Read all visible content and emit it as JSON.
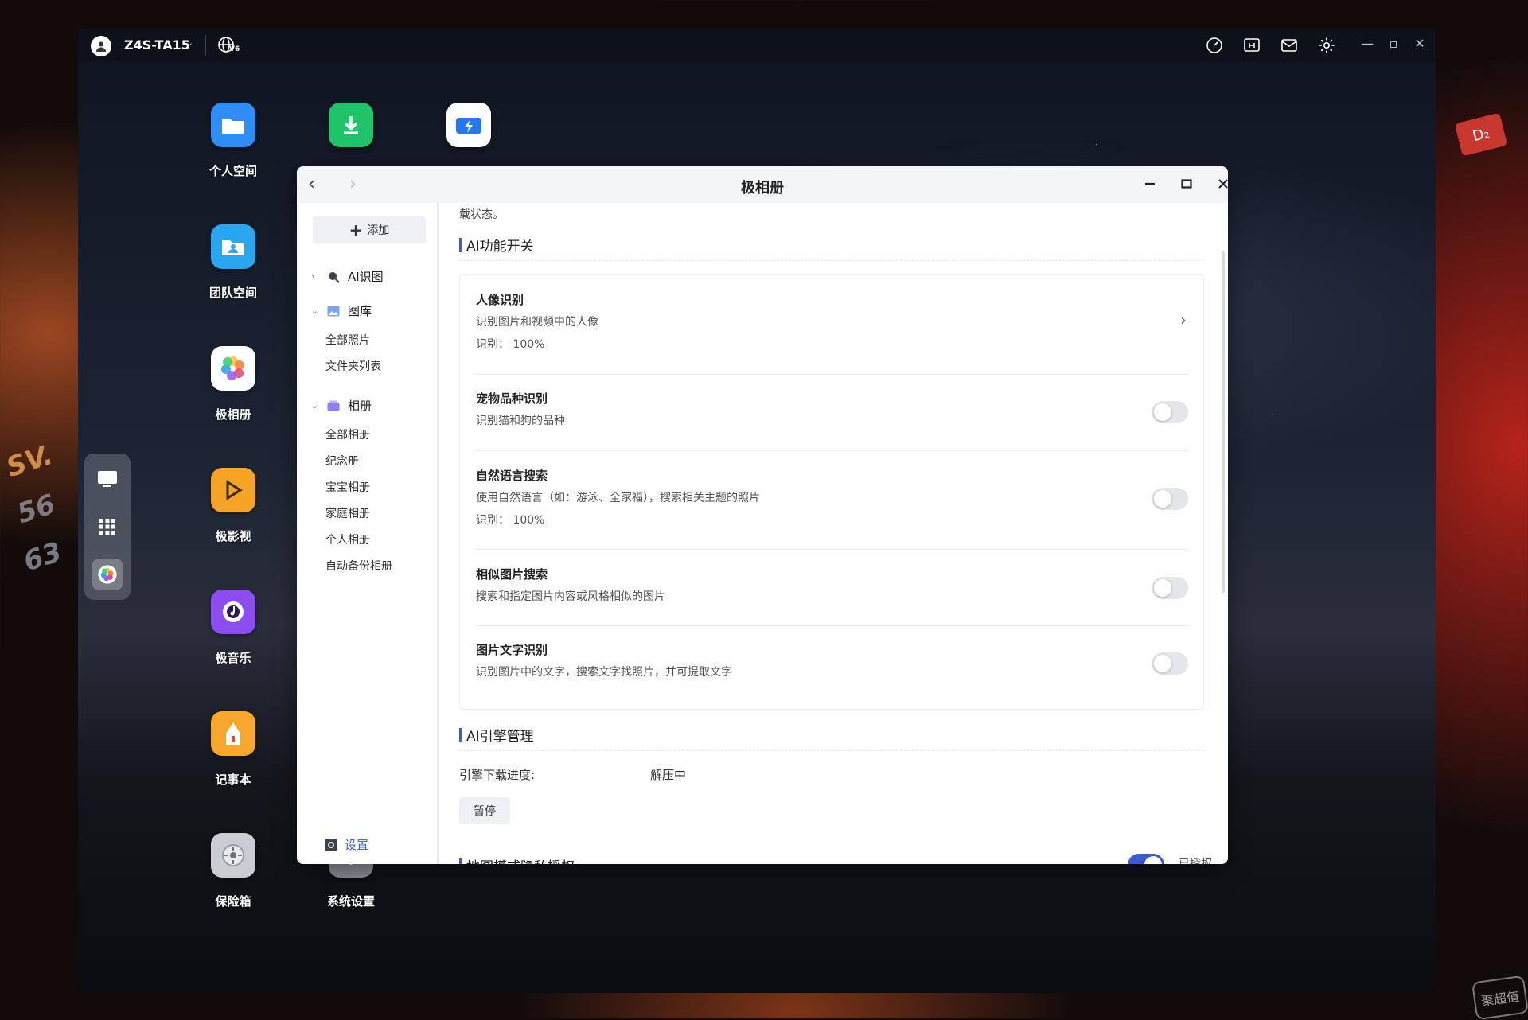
{
  "outer": {
    "deco_text_1": "SV.",
    "deco_text_2": "56",
    "deco_text_3": "63",
    "badge": "D₂",
    "watermark": "聚超值"
  },
  "topbar": {
    "device_name": "Z4S-TA15",
    "globe_badge": "V6"
  },
  "desktop_apps": [
    {
      "label": "个人空间",
      "icon": "folder-icon",
      "color": "#2f8ef5"
    },
    {
      "label": "",
      "icon": "download-icon",
      "color": "#1ec36a"
    },
    {
      "label": "",
      "icon": "lightning-icon",
      "color": "#2477ef"
    },
    {
      "label": "团队空间",
      "icon": "team-folder-icon",
      "color": "#2aa6f1"
    },
    {
      "label": "极相册",
      "icon": "photo-flower-icon",
      "color": "#ffffff"
    },
    {
      "label": "极影视",
      "icon": "video-icon",
      "color": "#f6a428"
    },
    {
      "label": "极音乐",
      "icon": "music-icon",
      "color": "#8b4cf0"
    },
    {
      "label": "记事本",
      "icon": "notepad-icon",
      "color": "#f7a62e"
    },
    {
      "label": "保险箱",
      "icon": "safe-icon",
      "color": "#c9ccd2"
    },
    {
      "label": "系统设置",
      "icon": "settings-icon",
      "color": "#8a8f99"
    }
  ],
  "window": {
    "title": "极相册",
    "sidebar": {
      "add_label": "添加",
      "groups": [
        {
          "label": "AI识图",
          "expanded": false
        },
        {
          "label": "图库",
          "expanded": true,
          "items": [
            "全部照片",
            "文件夹列表"
          ]
        },
        {
          "label": "相册",
          "expanded": true,
          "items": [
            "全部相册",
            "纪念册",
            "宝宝相册",
            "家庭相册",
            "个人相册",
            "自动备份相册"
          ]
        }
      ],
      "settings_label": "设置"
    },
    "content": {
      "partial_top_text": "载状态。",
      "ai_section_title": "AI功能开关",
      "features": [
        {
          "title": "人像识别",
          "desc": "识别图片和视频中的人像",
          "meta": "识别： 100%",
          "control": "chevron"
        },
        {
          "title": "宠物品种识别",
          "desc": "识别猫和狗的品种",
          "meta": "",
          "control": "toggle-off"
        },
        {
          "title": "自然语言搜索",
          "desc": "使用自然语言（如：游泳、全家福），搜索相关主题的照片",
          "meta": "识别： 100%",
          "control": "toggle-off"
        },
        {
          "title": "相似图片搜索",
          "desc": "搜索和指定图片内容或风格相似的图片",
          "meta": "",
          "control": "toggle-off"
        },
        {
          "title": "图片文字识别",
          "desc": "识别图片中的文字，搜索文字找照片，并可提取文字",
          "meta": "",
          "control": "toggle-off"
        }
      ],
      "engine_section_title": "AI引擎管理",
      "engine_progress_label": "引擎下载进度:",
      "engine_progress_value": "解压中",
      "pause_label": "暂停",
      "cut_section_title": "地图模式隐私授权",
      "cut_status": "已授权"
    }
  },
  "colors": {
    "accent": "#3b5bdb",
    "toggle_off": "#e4e6ea"
  }
}
